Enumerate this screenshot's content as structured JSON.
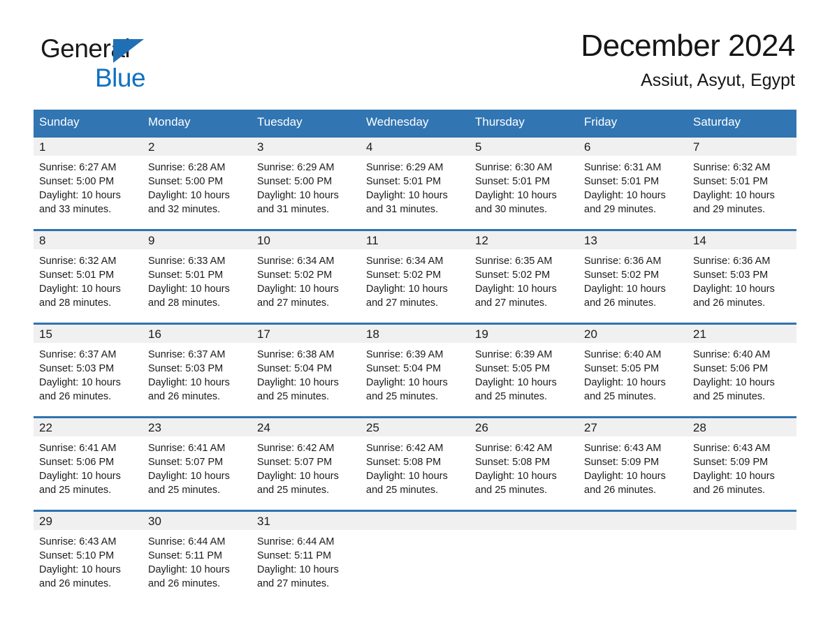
{
  "brand": {
    "name_part1": "General",
    "name_part2": "Blue",
    "triangle_icon": "brand-triangle-icon",
    "colors": {
      "black": "#1a1a1a",
      "blue": "#0f71c1",
      "triangle": "#1f6fb5"
    }
  },
  "header": {
    "title": "December 2024",
    "location": "Assiut, Asyut, Egypt"
  },
  "theme": {
    "header_blue": "#3175b2",
    "row_border_blue": "#2f73b0",
    "daynum_band_gray": "#f0f0f0",
    "page_background": "#ffffff",
    "text": "#1b1b1b"
  },
  "weekday_headers": [
    "Sunday",
    "Monday",
    "Tuesday",
    "Wednesday",
    "Thursday",
    "Friday",
    "Saturday"
  ],
  "weeks": [
    {
      "days": [
        {
          "date": "1",
          "sunrise": "Sunrise: 6:27 AM",
          "sunset": "Sunset: 5:00 PM",
          "daylight_line1": "Daylight: 10 hours",
          "daylight_line2": "and 33 minutes."
        },
        {
          "date": "2",
          "sunrise": "Sunrise: 6:28 AM",
          "sunset": "Sunset: 5:00 PM",
          "daylight_line1": "Daylight: 10 hours",
          "daylight_line2": "and 32 minutes."
        },
        {
          "date": "3",
          "sunrise": "Sunrise: 6:29 AM",
          "sunset": "Sunset: 5:00 PM",
          "daylight_line1": "Daylight: 10 hours",
          "daylight_line2": "and 31 minutes."
        },
        {
          "date": "4",
          "sunrise": "Sunrise: 6:29 AM",
          "sunset": "Sunset: 5:01 PM",
          "daylight_line1": "Daylight: 10 hours",
          "daylight_line2": "and 31 minutes."
        },
        {
          "date": "5",
          "sunrise": "Sunrise: 6:30 AM",
          "sunset": "Sunset: 5:01 PM",
          "daylight_line1": "Daylight: 10 hours",
          "daylight_line2": "and 30 minutes."
        },
        {
          "date": "6",
          "sunrise": "Sunrise: 6:31 AM",
          "sunset": "Sunset: 5:01 PM",
          "daylight_line1": "Daylight: 10 hours",
          "daylight_line2": "and 29 minutes."
        },
        {
          "date": "7",
          "sunrise": "Sunrise: 6:32 AM",
          "sunset": "Sunset: 5:01 PM",
          "daylight_line1": "Daylight: 10 hours",
          "daylight_line2": "and 29 minutes."
        }
      ]
    },
    {
      "days": [
        {
          "date": "8",
          "sunrise": "Sunrise: 6:32 AM",
          "sunset": "Sunset: 5:01 PM",
          "daylight_line1": "Daylight: 10 hours",
          "daylight_line2": "and 28 minutes."
        },
        {
          "date": "9",
          "sunrise": "Sunrise: 6:33 AM",
          "sunset": "Sunset: 5:01 PM",
          "daylight_line1": "Daylight: 10 hours",
          "daylight_line2": "and 28 minutes."
        },
        {
          "date": "10",
          "sunrise": "Sunrise: 6:34 AM",
          "sunset": "Sunset: 5:02 PM",
          "daylight_line1": "Daylight: 10 hours",
          "daylight_line2": "and 27 minutes."
        },
        {
          "date": "11",
          "sunrise": "Sunrise: 6:34 AM",
          "sunset": "Sunset: 5:02 PM",
          "daylight_line1": "Daylight: 10 hours",
          "daylight_line2": "and 27 minutes."
        },
        {
          "date": "12",
          "sunrise": "Sunrise: 6:35 AM",
          "sunset": "Sunset: 5:02 PM",
          "daylight_line1": "Daylight: 10 hours",
          "daylight_line2": "and 27 minutes."
        },
        {
          "date": "13",
          "sunrise": "Sunrise: 6:36 AM",
          "sunset": "Sunset: 5:02 PM",
          "daylight_line1": "Daylight: 10 hours",
          "daylight_line2": "and 26 minutes."
        },
        {
          "date": "14",
          "sunrise": "Sunrise: 6:36 AM",
          "sunset": "Sunset: 5:03 PM",
          "daylight_line1": "Daylight: 10 hours",
          "daylight_line2": "and 26 minutes."
        }
      ]
    },
    {
      "days": [
        {
          "date": "15",
          "sunrise": "Sunrise: 6:37 AM",
          "sunset": "Sunset: 5:03 PM",
          "daylight_line1": "Daylight: 10 hours",
          "daylight_line2": "and 26 minutes."
        },
        {
          "date": "16",
          "sunrise": "Sunrise: 6:37 AM",
          "sunset": "Sunset: 5:03 PM",
          "daylight_line1": "Daylight: 10 hours",
          "daylight_line2": "and 26 minutes."
        },
        {
          "date": "17",
          "sunrise": "Sunrise: 6:38 AM",
          "sunset": "Sunset: 5:04 PM",
          "daylight_line1": "Daylight: 10 hours",
          "daylight_line2": "and 25 minutes."
        },
        {
          "date": "18",
          "sunrise": "Sunrise: 6:39 AM",
          "sunset": "Sunset: 5:04 PM",
          "daylight_line1": "Daylight: 10 hours",
          "daylight_line2": "and 25 minutes."
        },
        {
          "date": "19",
          "sunrise": "Sunrise: 6:39 AM",
          "sunset": "Sunset: 5:05 PM",
          "daylight_line1": "Daylight: 10 hours",
          "daylight_line2": "and 25 minutes."
        },
        {
          "date": "20",
          "sunrise": "Sunrise: 6:40 AM",
          "sunset": "Sunset: 5:05 PM",
          "daylight_line1": "Daylight: 10 hours",
          "daylight_line2": "and 25 minutes."
        },
        {
          "date": "21",
          "sunrise": "Sunrise: 6:40 AM",
          "sunset": "Sunset: 5:06 PM",
          "daylight_line1": "Daylight: 10 hours",
          "daylight_line2": "and 25 minutes."
        }
      ]
    },
    {
      "days": [
        {
          "date": "22",
          "sunrise": "Sunrise: 6:41 AM",
          "sunset": "Sunset: 5:06 PM",
          "daylight_line1": "Daylight: 10 hours",
          "daylight_line2": "and 25 minutes."
        },
        {
          "date": "23",
          "sunrise": "Sunrise: 6:41 AM",
          "sunset": "Sunset: 5:07 PM",
          "daylight_line1": "Daylight: 10 hours",
          "daylight_line2": "and 25 minutes."
        },
        {
          "date": "24",
          "sunrise": "Sunrise: 6:42 AM",
          "sunset": "Sunset: 5:07 PM",
          "daylight_line1": "Daylight: 10 hours",
          "daylight_line2": "and 25 minutes."
        },
        {
          "date": "25",
          "sunrise": "Sunrise: 6:42 AM",
          "sunset": "Sunset: 5:08 PM",
          "daylight_line1": "Daylight: 10 hours",
          "daylight_line2": "and 25 minutes."
        },
        {
          "date": "26",
          "sunrise": "Sunrise: 6:42 AM",
          "sunset": "Sunset: 5:08 PM",
          "daylight_line1": "Daylight: 10 hours",
          "daylight_line2": "and 25 minutes."
        },
        {
          "date": "27",
          "sunrise": "Sunrise: 6:43 AM",
          "sunset": "Sunset: 5:09 PM",
          "daylight_line1": "Daylight: 10 hours",
          "daylight_line2": "and 26 minutes."
        },
        {
          "date": "28",
          "sunrise": "Sunrise: 6:43 AM",
          "sunset": "Sunset: 5:09 PM",
          "daylight_line1": "Daylight: 10 hours",
          "daylight_line2": "and 26 minutes."
        }
      ]
    },
    {
      "days": [
        {
          "date": "29",
          "sunrise": "Sunrise: 6:43 AM",
          "sunset": "Sunset: 5:10 PM",
          "daylight_line1": "Daylight: 10 hours",
          "daylight_line2": "and 26 minutes."
        },
        {
          "date": "30",
          "sunrise": "Sunrise: 6:44 AM",
          "sunset": "Sunset: 5:11 PM",
          "daylight_line1": "Daylight: 10 hours",
          "daylight_line2": "and 26 minutes."
        },
        {
          "date": "31",
          "sunrise": "Sunrise: 6:44 AM",
          "sunset": "Sunset: 5:11 PM",
          "daylight_line1": "Daylight: 10 hours",
          "daylight_line2": "and 27 minutes."
        },
        {
          "date": "",
          "sunrise": "",
          "sunset": "",
          "daylight_line1": "",
          "daylight_line2": ""
        },
        {
          "date": "",
          "sunrise": "",
          "sunset": "",
          "daylight_line1": "",
          "daylight_line2": ""
        },
        {
          "date": "",
          "sunrise": "",
          "sunset": "",
          "daylight_line1": "",
          "daylight_line2": ""
        },
        {
          "date": "",
          "sunrise": "",
          "sunset": "",
          "daylight_line1": "",
          "daylight_line2": ""
        }
      ]
    }
  ]
}
